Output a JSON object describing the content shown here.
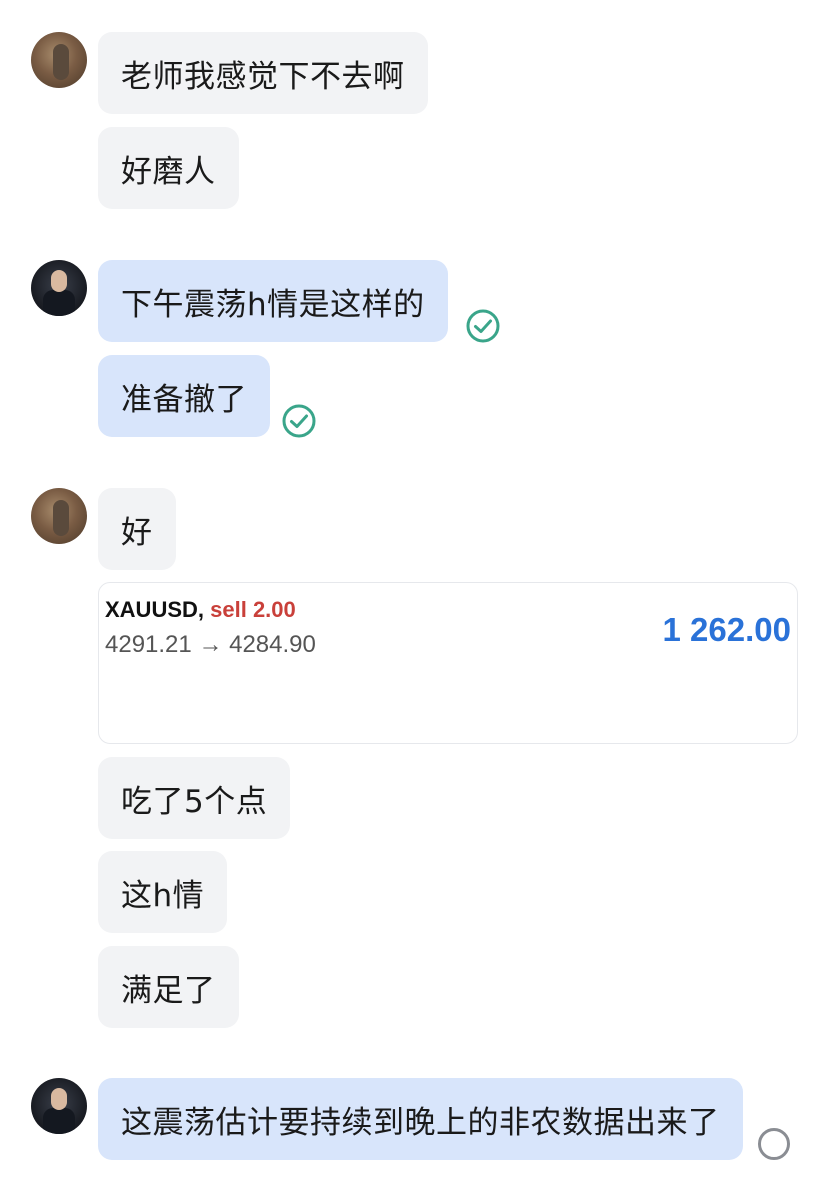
{
  "messages": [
    {
      "text": "老师我感觉下不去啊"
    },
    {
      "text": "好磨人"
    },
    {
      "text": "下午震荡h情是这样的"
    },
    {
      "text": "准备撤了"
    },
    {
      "text": "好"
    },
    {
      "text": "吃了5个点"
    },
    {
      "text": "这h情"
    },
    {
      "text": "满足了"
    },
    {
      "text": "这震荡估计要持续到晚上的非农数据出来了"
    }
  ],
  "trade_card": {
    "symbol": "XAUUSD,",
    "side": "sell 2.00",
    "open_price": "4291.21",
    "arrow": "→",
    "close_price": "4284.90",
    "profit": "1 262.00"
  },
  "colors": {
    "incoming_bubble": "#f2f3f5",
    "outgoing_bubble": "#d8e5fb",
    "check_green": "#3aa58a",
    "sell_red": "#c9403a",
    "profit_blue": "#2a72d8"
  },
  "icons": {
    "delivered": "check-circle-icon",
    "pending": "empty-circle-icon"
  }
}
